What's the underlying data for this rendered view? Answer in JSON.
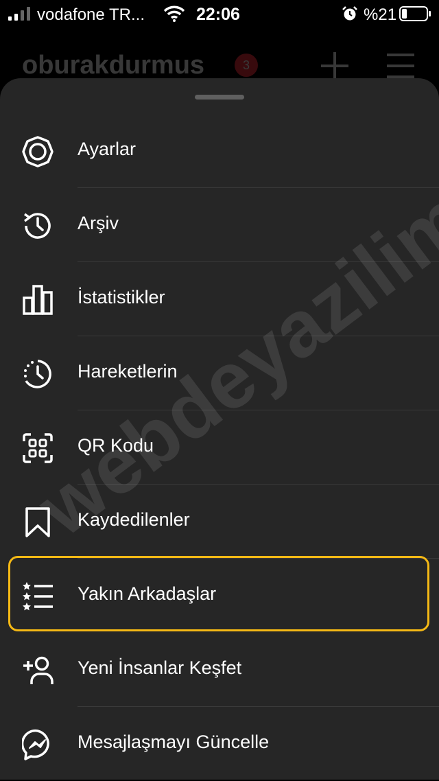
{
  "status_bar": {
    "carrier": "vodafone TR...",
    "time": "22:06",
    "battery_text": "%21",
    "battery_level": 0.21,
    "signal_icon": "cellular-signal-icon",
    "wifi_icon": "wifi-icon",
    "alarm_icon": "alarm-icon"
  },
  "profile": {
    "username": "oburakdurmus",
    "notification_count": "3"
  },
  "menu": {
    "items": [
      {
        "label": "Ayarlar",
        "icon": "settings-icon"
      },
      {
        "label": "Arşiv",
        "icon": "archive-history-icon"
      },
      {
        "label": "İstatistikler",
        "icon": "bar-chart-icon"
      },
      {
        "label": "Hareketlerin",
        "icon": "activity-clock-icon"
      },
      {
        "label": "QR Kodu",
        "icon": "qr-code-icon"
      },
      {
        "label": "Kaydedilenler",
        "icon": "bookmark-icon"
      },
      {
        "label": "Yakın Arkadaşlar",
        "icon": "close-friends-list-icon",
        "highlighted": true
      },
      {
        "label": "Yeni İnsanlar Keşfet",
        "icon": "add-person-icon"
      },
      {
        "label": "Mesajlaşmayı Güncelle",
        "icon": "messenger-icon"
      }
    ]
  },
  "watermark": "webdeyazilim.com",
  "colors": {
    "sheet_background": "#262626",
    "highlight_border": "#f5b915",
    "badge": "#ff2d3e"
  }
}
